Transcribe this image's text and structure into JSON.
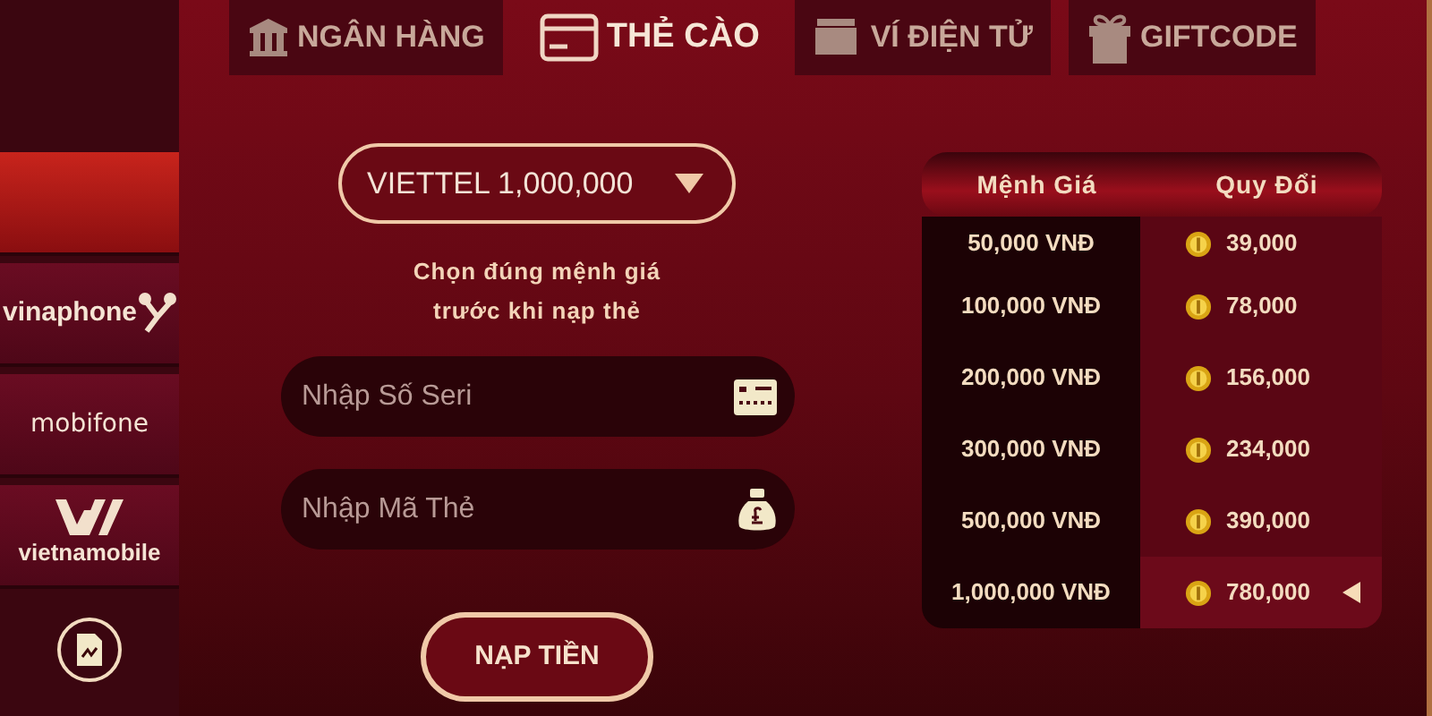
{
  "tabs": [
    {
      "label": "NGÂN HÀNG",
      "selected": false
    },
    {
      "label": "THẺ CÀO",
      "selected": true
    },
    {
      "label": "VÍ ĐIỆN TỬ",
      "selected": false
    },
    {
      "label": "GIFTCODE",
      "selected": false
    }
  ],
  "sidebar": {
    "items": [
      {
        "kind": "blank",
        "selected": true
      },
      {
        "kind": "vinaphone",
        "label": "vinaphone",
        "selected": false
      },
      {
        "kind": "mobifone",
        "label": "mobifone",
        "selected": false
      },
      {
        "kind": "vietnamobile",
        "label": "vietnamobile",
        "selected": false
      },
      {
        "kind": "icon",
        "selected": false
      }
    ]
  },
  "form": {
    "amount_select": "VIETTEL 1,000,000",
    "hint": "Chọn đúng mệnh giá\ntrước khi nạp thẻ",
    "fields": [
      {
        "placeholder": "Nhập Số Seri"
      },
      {
        "placeholder": "Nhập Mã Thẻ"
      }
    ],
    "submit": "NẠP TIỀN"
  },
  "table": {
    "columns": [
      "Mệnh Giá",
      "Quy Đổi"
    ],
    "rows": [
      {
        "value": "50,000 VNĐ",
        "exchange": "39,000",
        "selected": false
      },
      {
        "value": "100,000 VNĐ",
        "exchange": "78,000",
        "selected": false
      },
      {
        "value": "200,000 VNĐ",
        "exchange": "156,000",
        "selected": false
      },
      {
        "value": "300,000 VNĐ",
        "exchange": "234,000",
        "selected": false
      },
      {
        "value": "500,000 VNĐ",
        "exchange": "390,000",
        "selected": false
      },
      {
        "value": "1,000,000 VNĐ",
        "exchange": "780,000",
        "selected": true
      }
    ]
  }
}
